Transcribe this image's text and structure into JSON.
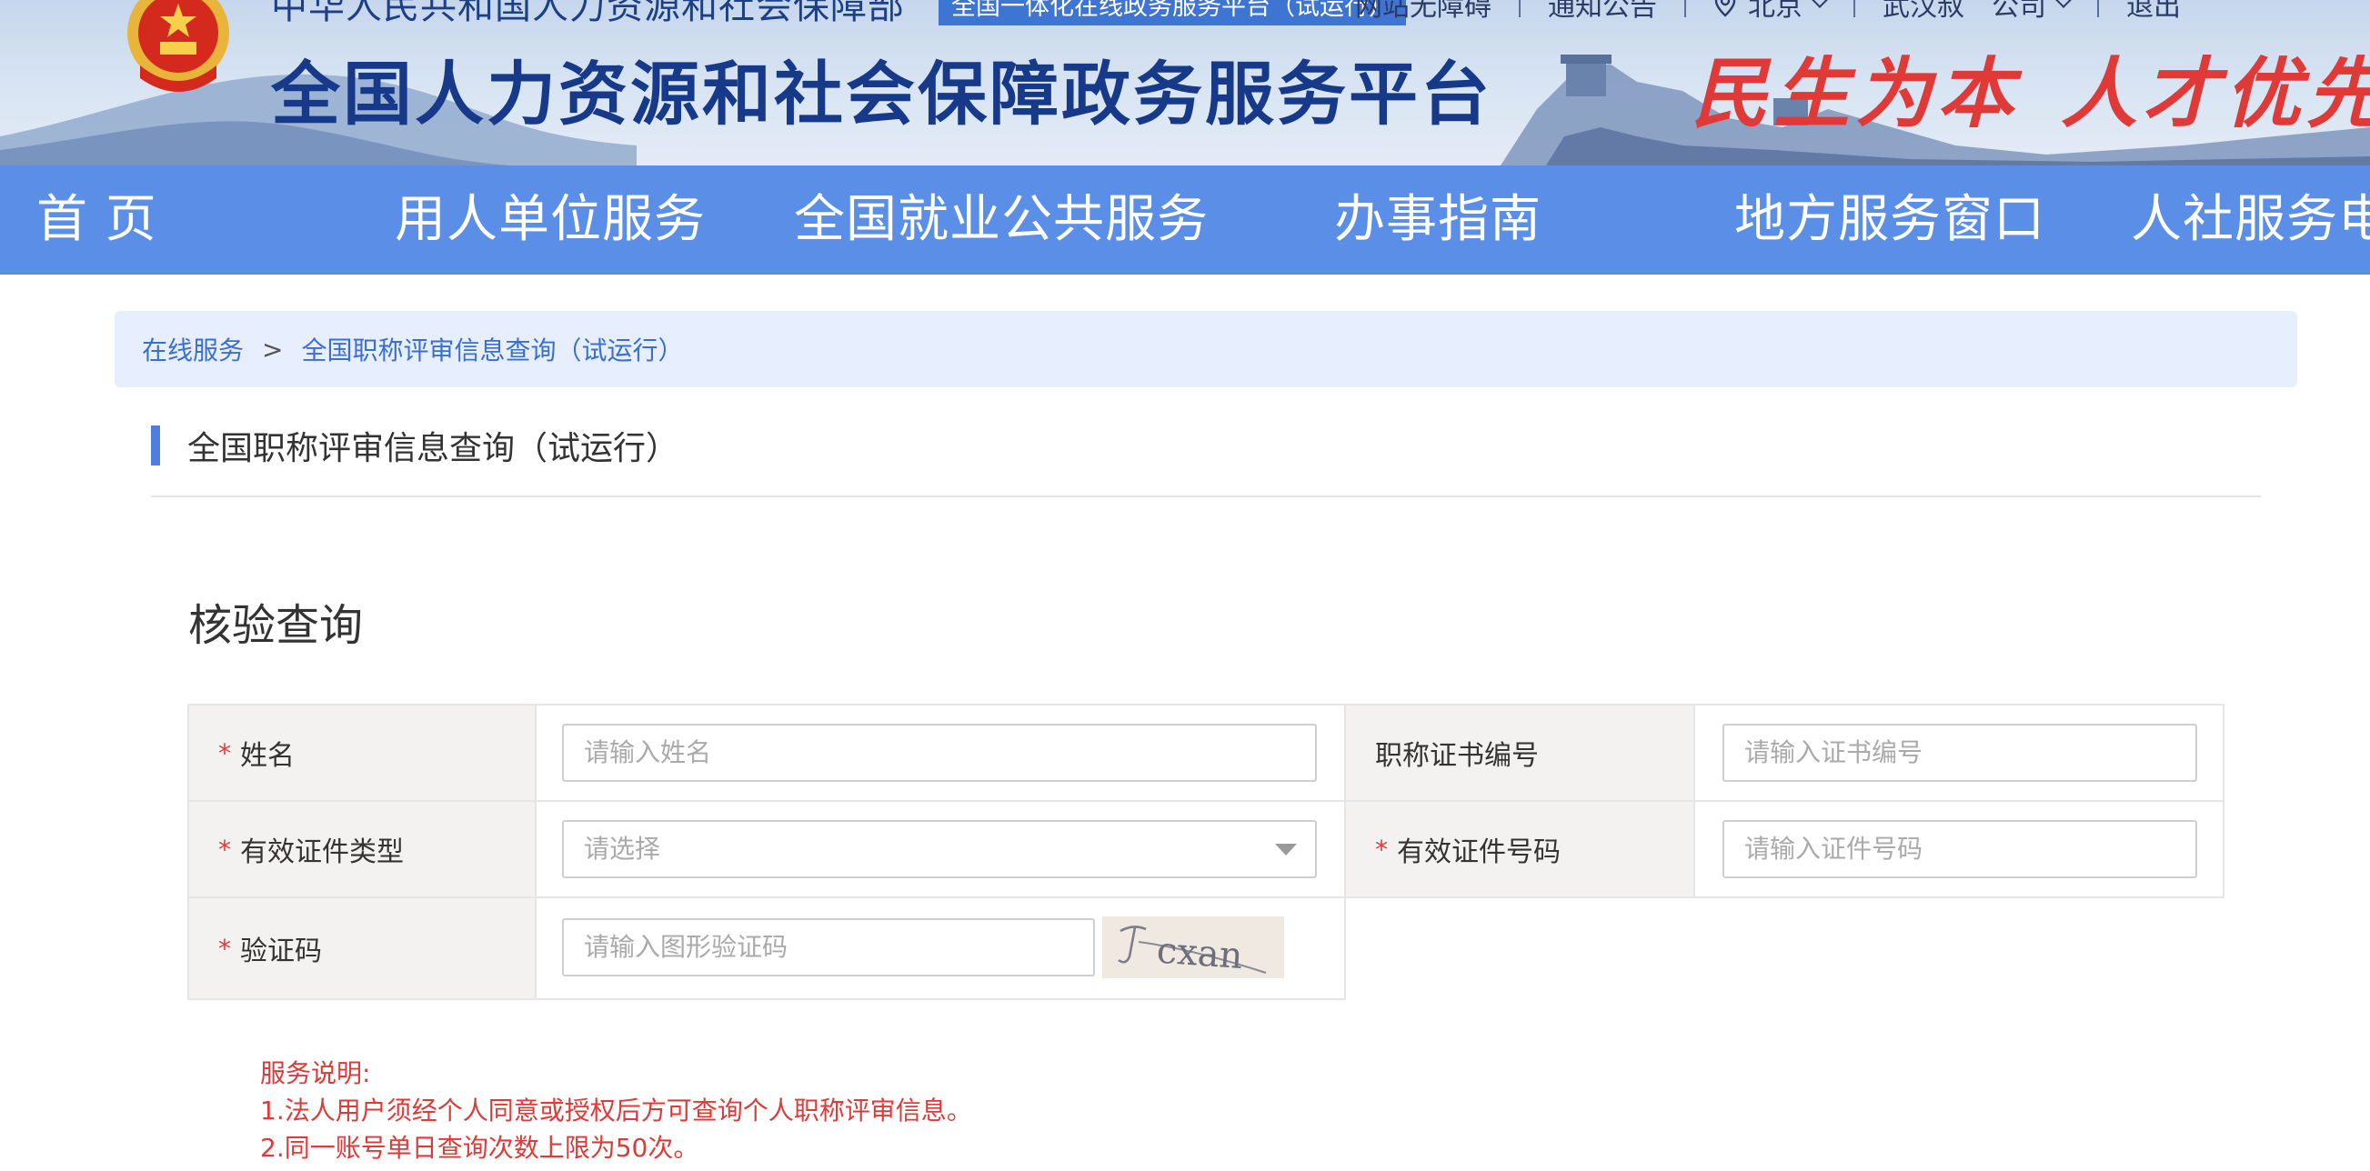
{
  "header": {
    "ministry_name": "中华人民共和国人力资源和社会保障部",
    "tag": "全国一体化在线政务服务平台（试运行）",
    "platform_title": "全国人力资源和社会保障政务服务平台",
    "slogan_left": "民生为本",
    "slogan_right": "人才优先",
    "top_links": {
      "accessibility": "网站无障碍",
      "notice": "通知公告",
      "city": "北京",
      "user": "武汉叔",
      "company": "公司",
      "logout": "退出"
    }
  },
  "nav": {
    "items": [
      "首 页",
      "用人单位服务",
      "全国就业公共服务",
      "办事指南",
      "地方服务窗口",
      "人社服务电"
    ]
  },
  "breadcrumb": {
    "root": "在线服务",
    "separator": ">",
    "current": "全国职称评审信息查询（试运行）"
  },
  "page": {
    "section_title": "全国职称评审信息查询（试运行）",
    "panel_title": "核验查询"
  },
  "form": {
    "required_mark": "*",
    "name": {
      "label": "姓名",
      "placeholder": "请输入姓名"
    },
    "cert_no": {
      "label": "职称证书编号",
      "placeholder": "请输入证书编号"
    },
    "id_type": {
      "label": "有效证件类型",
      "placeholder": "请选择"
    },
    "id_no": {
      "label": "有效证件号码",
      "placeholder": "请输入证件号码"
    },
    "captcha": {
      "label": "验证码",
      "placeholder": "请输入图形验证码",
      "image_text": "cxan"
    }
  },
  "notes": {
    "title": "服务说明:",
    "lines": [
      "1.法人用户须经个人同意或授权后方可查询个人职称评审信息。",
      "2.同一账号单日查询次数上限为50次。"
    ]
  },
  "colors": {
    "nav_bg": "#5b8ee7",
    "title_blue": "#17398a",
    "slogan_red": "#e03a38",
    "link_blue": "#3a6fd0",
    "required_red": "#e03a38"
  }
}
